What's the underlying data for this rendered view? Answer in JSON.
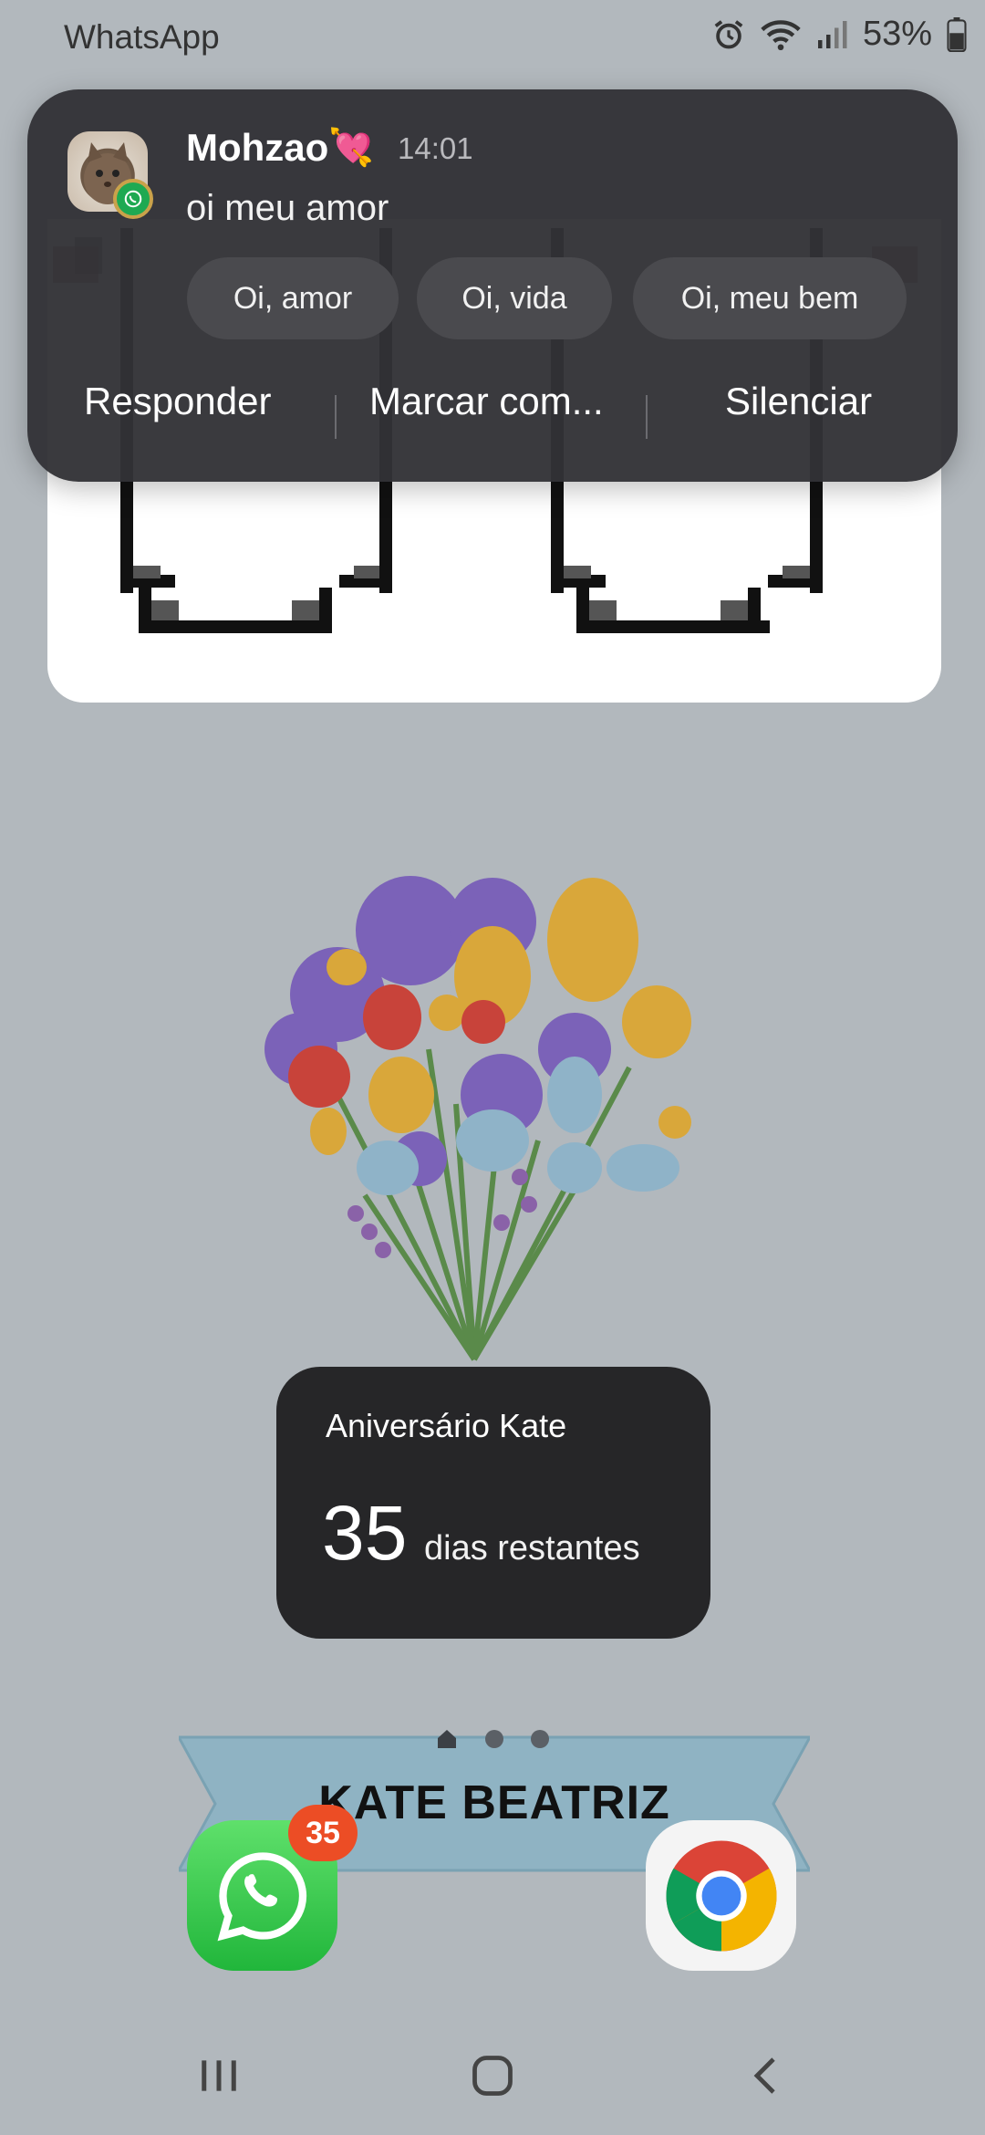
{
  "status_bar": {
    "app_label": "WhatsApp",
    "battery_percent": "53%",
    "icons": [
      "alarm-icon",
      "wifi-icon",
      "signal-icon",
      "battery-icon"
    ]
  },
  "notification": {
    "sender": "Mohzao",
    "sender_emoji": "💘",
    "time": "14:01",
    "message": "oi meu amor",
    "quick_replies": [
      "Oi, amor",
      "Oi, vida",
      "Oi, meu bem"
    ],
    "actions": [
      "Responder",
      "Marcar com...",
      "Silenciar"
    ]
  },
  "countdown": {
    "title": "Aniversário Kate",
    "number": "35",
    "unit": "dias restantes"
  },
  "banner": {
    "text": "KATE BEATRIZ"
  },
  "dock": {
    "whatsapp_badge": "35"
  },
  "colors": {
    "wallpaper": "#b2b8bd",
    "notification_bg": "#323236",
    "whatsapp_green": "#21b63b",
    "badge_red": "#ec4d25"
  }
}
